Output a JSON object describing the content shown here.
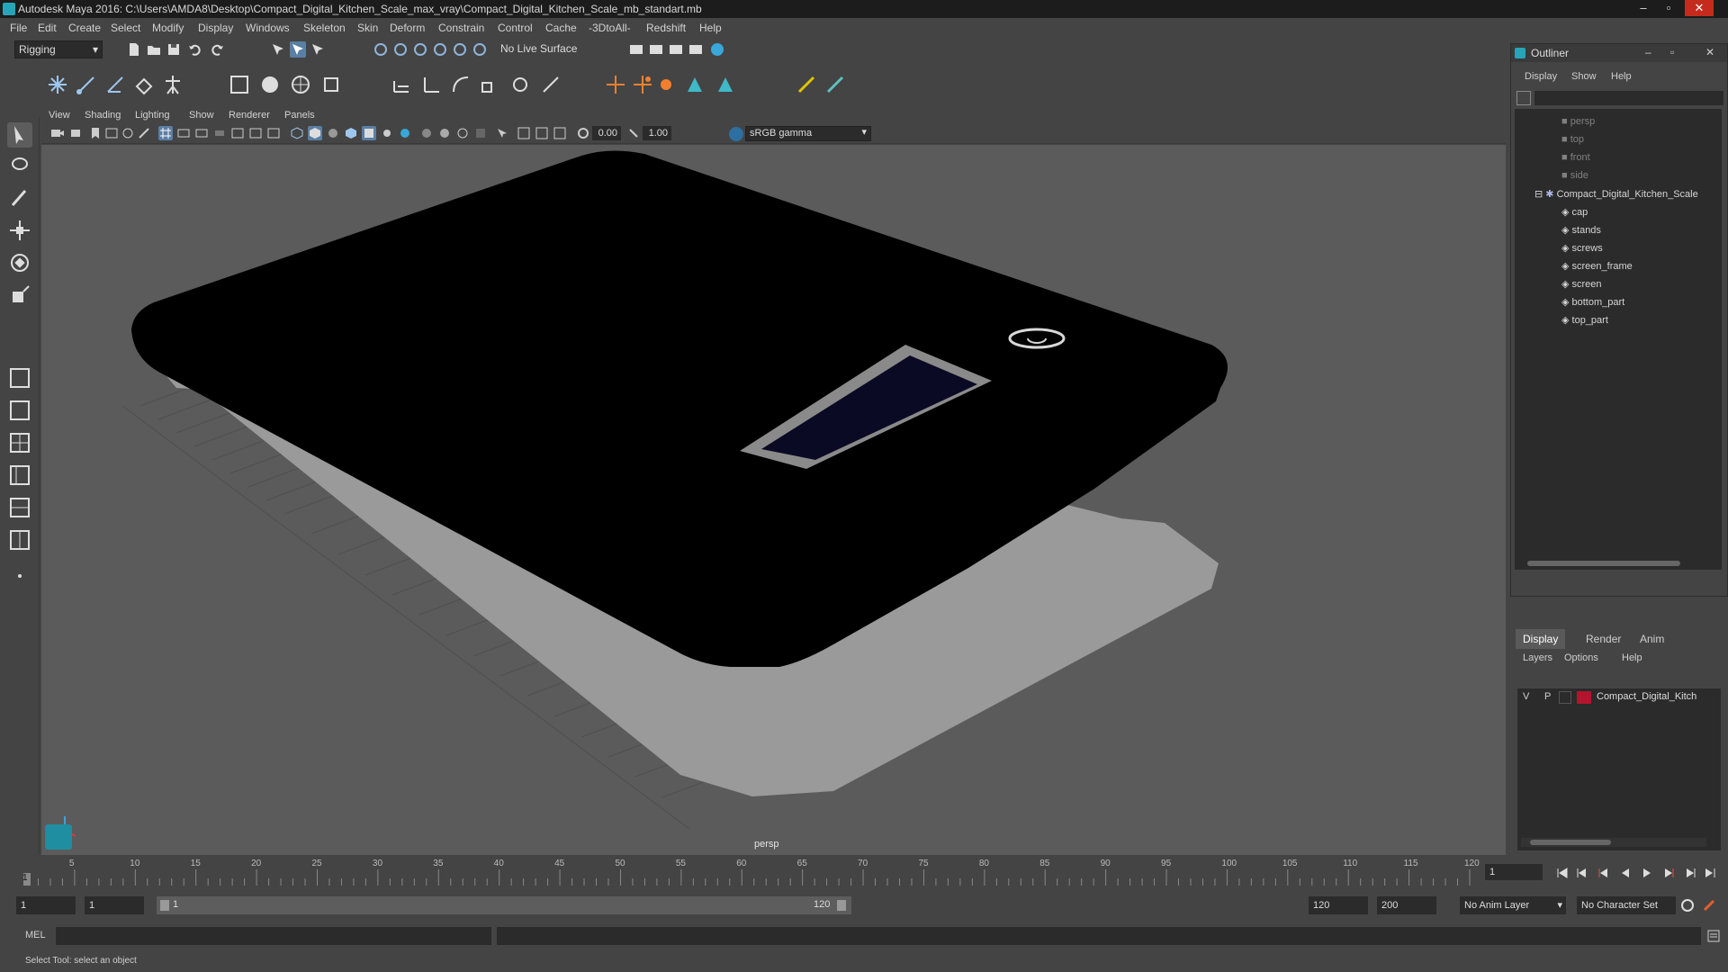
{
  "window": {
    "title": "Autodesk Maya 2016: C:\\Users\\AMDA8\\Desktop\\Compact_Digital_Kitchen_Scale_max_vray\\Compact_Digital_Kitchen_Scale_mb_standart.mb",
    "minimize": "–",
    "maximize": "▫",
    "close": "✕"
  },
  "menubar": [
    "File",
    "Edit",
    "Create",
    "Select",
    "Modify",
    "Display",
    "Windows",
    "Skeleton",
    "Skin",
    "Deform",
    "Constrain",
    "Control",
    "Cache",
    "-3DtoAll-",
    "Redshift",
    "Help"
  ],
  "toolbar": {
    "menu_set": "Rigging",
    "live_surface": "No Live Surface"
  },
  "panel_menu": [
    "View",
    "Shading",
    "Lighting",
    "Show",
    "Renderer",
    "Panels"
  ],
  "view_toolbar": {
    "exposure": "0.00",
    "gamma": "1.00",
    "color_space": "sRGB gamma"
  },
  "viewport": {
    "camera_label": "persp"
  },
  "outliner": {
    "title": "Outliner",
    "menu": [
      "Display",
      "Show",
      "Help"
    ],
    "cameras": [
      "persp",
      "top",
      "front",
      "side"
    ],
    "group": "Compact_Digital_Kitchen_Scale",
    "children": [
      "cap",
      "stands",
      "screws",
      "screen_frame",
      "screen",
      "bottom_part",
      "top_part"
    ]
  },
  "layer_editor": {
    "tabs": [
      "Display",
      "Render",
      "Anim"
    ],
    "menu": [
      "Layers",
      "Options",
      "Help"
    ],
    "layer": {
      "visible": "V",
      "playback": "P",
      "name": "Compact_Digital_Kitch",
      "color": "#b3142e"
    }
  },
  "timeline": {
    "ticks": [
      "5",
      "10",
      "15",
      "20",
      "25",
      "30",
      "35",
      "40",
      "45",
      "50",
      "55",
      "60",
      "65",
      "70",
      "75",
      "80",
      "85",
      "90",
      "95",
      "100",
      "105",
      "110",
      "115",
      "120"
    ],
    "start_tick": "1",
    "current_frame": "1"
  },
  "range": {
    "start": "1",
    "playback_start": "1",
    "slider_start": "1",
    "slider_end": "120",
    "playback_end": "120",
    "end": "200",
    "anim_layer": "No Anim Layer",
    "character_set": "No Character Set"
  },
  "command_line": {
    "language": "MEL"
  },
  "help_line": {
    "text": "Select Tool: select an object"
  },
  "colors": {
    "accent": "#25a6b8",
    "viewport_bg": "#5b5b5b",
    "object": "#000000",
    "rim": "#9a9a9a"
  }
}
